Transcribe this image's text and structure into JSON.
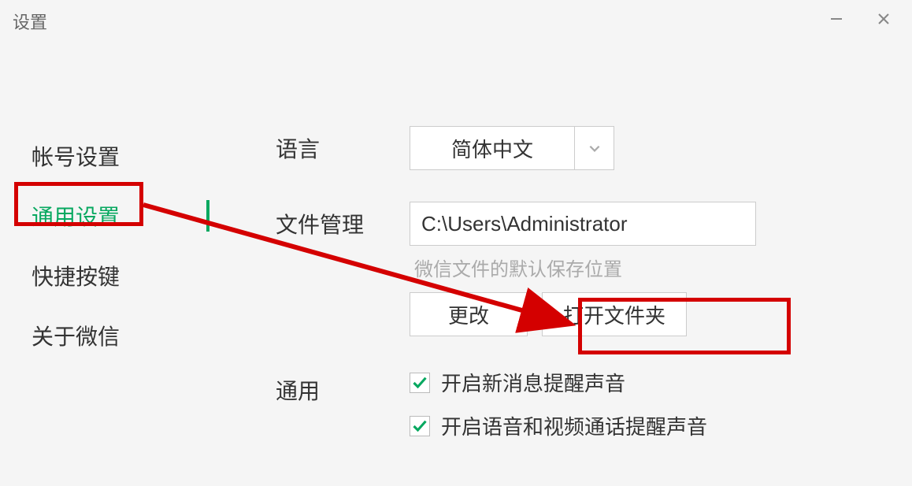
{
  "window": {
    "title": "设置"
  },
  "sidebar": {
    "items": [
      {
        "label": "帐号设置"
      },
      {
        "label": "通用设置"
      },
      {
        "label": "快捷按键"
      },
      {
        "label": "关于微信"
      }
    ],
    "active_index": 1
  },
  "language": {
    "label": "语言",
    "value": "简体中文"
  },
  "file_manage": {
    "label": "文件管理",
    "path": "C:\\Users\\Administrator",
    "help": "微信文件的默认保存位置",
    "change_button": "更改",
    "open_folder_button": "打开文件夹"
  },
  "general": {
    "label": "通用",
    "checks": [
      {
        "label": "开启新消息提醒声音",
        "checked": true
      },
      {
        "label": "开启语音和视频通话提醒声音",
        "checked": true
      }
    ]
  },
  "annotation": {
    "highlight_color": "#d40000"
  }
}
